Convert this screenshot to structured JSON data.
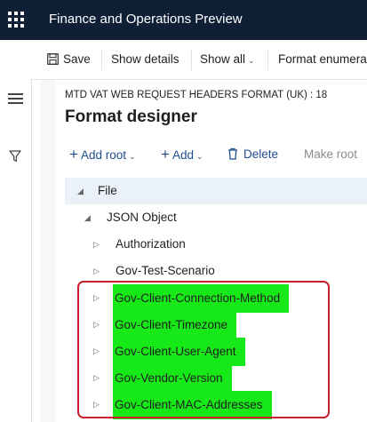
{
  "header": {
    "app_title": "Finance and Operations Preview"
  },
  "icons": [
    "waffle-icon",
    "hamburger-icon",
    "filter-icon",
    "save-icon",
    "delete-icon",
    "chevron-down-icon",
    "expand-icon",
    "collapse-icon"
  ],
  "actionpane": {
    "save_label": "Save",
    "show_details_label": "Show details",
    "show_all_label": "Show all",
    "format_enum_label": "Format enumera"
  },
  "page": {
    "caption": "MTD VAT WEB REQUEST HEADERS FORMAT (UK) : 18",
    "title": "Format designer"
  },
  "toolbar": {
    "add_root_label": "Add root",
    "add_label": "Add",
    "delete_label": "Delete",
    "make_root_label": "Make root"
  },
  "tree": {
    "root": "File",
    "child": "JSON Object",
    "items": [
      "Authorization",
      "Gov-Test-Scenario",
      "Gov-Client-Connection-Method",
      "Gov-Client-Timezone",
      "Gov-Client-User-Agent",
      "Gov-Vendor-Version",
      "Gov-Client-MAC-Addresses"
    ]
  },
  "colors": {
    "header": "#0f1f36",
    "accent": "#1f4e8c",
    "highlight": "#17e817",
    "callout": "#c8202a"
  }
}
